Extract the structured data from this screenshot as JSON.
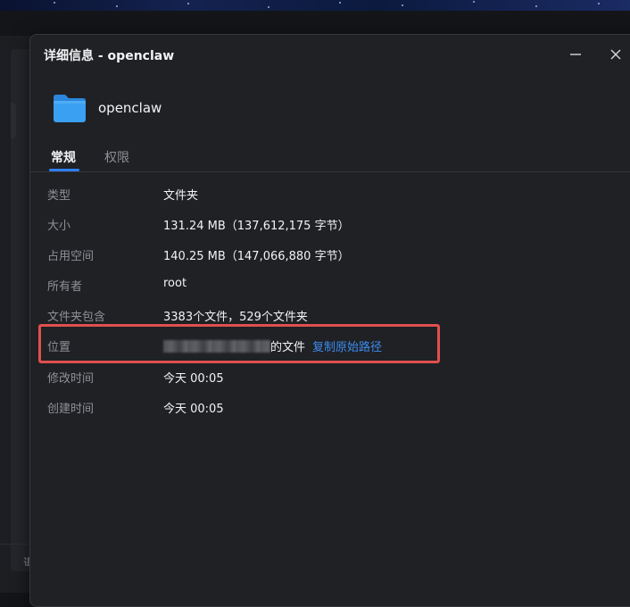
{
  "window": {
    "title": "详细信息 - openclaw"
  },
  "header": {
    "folder_name": "openclaw"
  },
  "tabs": [
    {
      "label": "常规",
      "active": true
    },
    {
      "label": "权限",
      "active": false
    }
  ],
  "info": {
    "type": {
      "label": "类型",
      "value": "文件夹"
    },
    "size": {
      "label": "大小",
      "value": "131.24 MB（137,612,175 字节）"
    },
    "disk_usage": {
      "label": "占用空间",
      "value": "140.25 MB（147,066,880 字节）"
    },
    "owner": {
      "label": "所有者",
      "value": "root"
    },
    "contains": {
      "label": "文件夹包含",
      "value": "3383个文件，529个文件夹"
    },
    "location": {
      "label": "位置",
      "value_suffix": "的文件",
      "copy_link": "复制原始路径"
    },
    "modified": {
      "label": "修改时间",
      "value": "今天 00:05"
    },
    "created": {
      "label": "创建时间",
      "value": "今天 00:05"
    }
  },
  "background": {
    "partial_text": "退"
  },
  "colors": {
    "accent": "#2f7ff0",
    "link": "#3b8cf0",
    "highlight": "#e0504e",
    "folder": "#3aa0f2"
  },
  "icons": [
    "minimize-icon",
    "close-icon",
    "folder-icon"
  ]
}
